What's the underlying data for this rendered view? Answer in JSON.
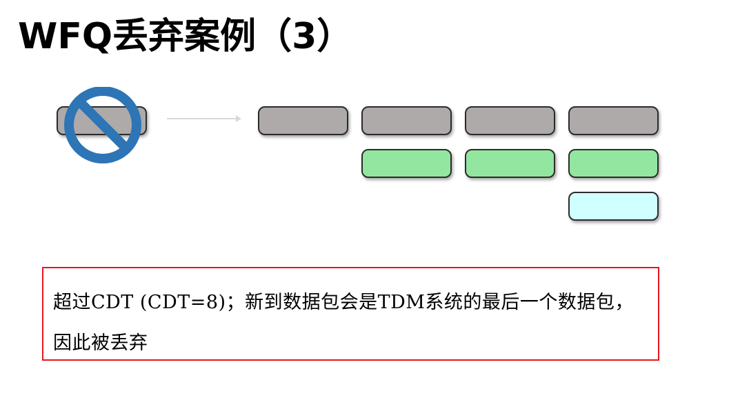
{
  "slide": {
    "title": "WFQ丢弃案例（3）",
    "note": "超过CDT (CDT=8)；新到数据包会是TDM系统的最后一个数据包，因此被丢弃"
  },
  "colors": {
    "packet_gray": "#aeaaaa",
    "packet_green": "#93e6a0",
    "packet_cyan": "#cfffff",
    "prohibit_blue": "#2e75b6",
    "note_border_red": "#e8141b",
    "arrow_gray": "#d9d9d9"
  },
  "diagram": {
    "incoming_packet": {
      "color": "packet_gray",
      "status": "discarded",
      "icon": "prohibited-icon"
    },
    "queues": [
      {
        "packets": [
          "packet_gray"
        ]
      },
      {
        "packets": [
          "packet_gray",
          "packet_green"
        ]
      },
      {
        "packets": [
          "packet_gray",
          "packet_green"
        ]
      },
      {
        "packets": [
          "packet_gray",
          "packet_green",
          "packet_cyan"
        ]
      }
    ]
  }
}
